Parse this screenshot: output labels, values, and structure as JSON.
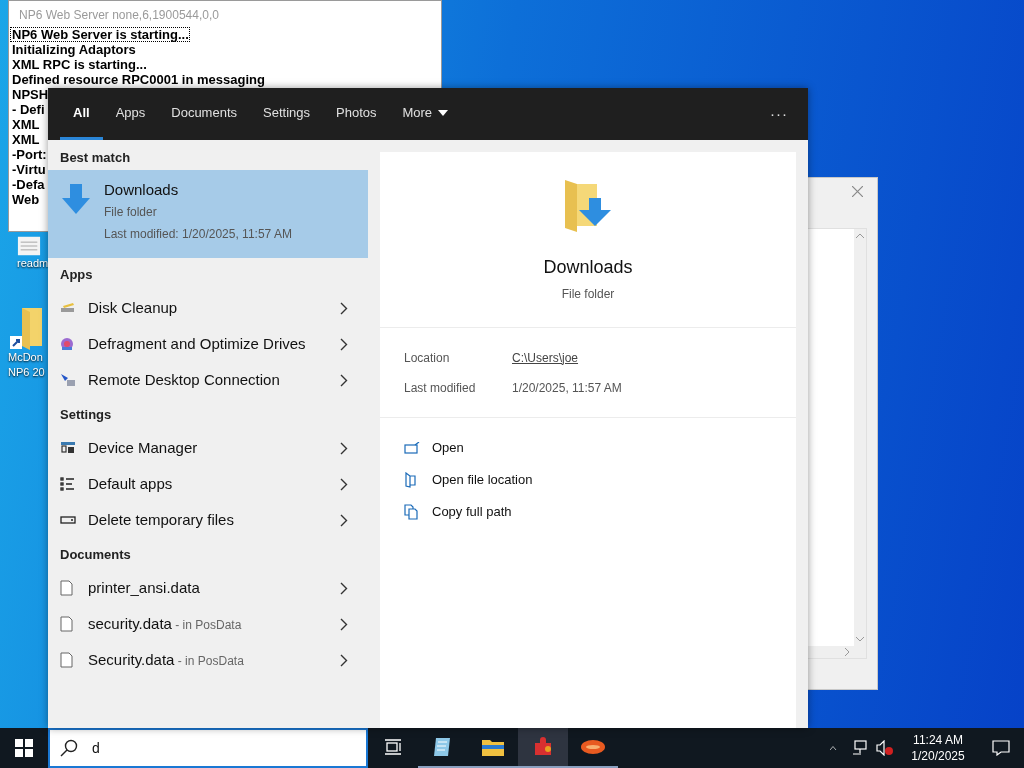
{
  "console_window": {
    "title": "NP6 Web Server none,6,1900544,0,0",
    "lines": [
      {
        "text": "NP6 Web Server is starting...",
        "focused": true
      },
      {
        "text": "Initializing Adaptors",
        "focused": false
      },
      {
        "text": "XML RPC is starting...",
        "focused": false
      },
      {
        "text": "Defined resource RPC0001 in messaging",
        "focused": false
      },
      {
        "text": "NPSH",
        "focused": false
      },
      {
        "text": "- Defi",
        "focused": false
      },
      {
        "text": "XML",
        "focused": false
      },
      {
        "text": "XML",
        "focused": false
      },
      {
        "text": "-Port:",
        "focused": false
      },
      {
        "text": "-Virtu",
        "focused": false
      },
      {
        "text": "-Defa",
        "focused": false
      },
      {
        "text": "Web",
        "focused": false
      }
    ]
  },
  "desktop_icons": [
    {
      "kind": "document",
      "lines": [
        "readm"
      ]
    },
    {
      "kind": "folder-shortcut",
      "lines": [
        "McDon",
        "NP6 20"
      ]
    }
  ],
  "search_panel": {
    "tabs": [
      {
        "label": "All",
        "selected": true,
        "dropdown": false
      },
      {
        "label": "Apps",
        "selected": false,
        "dropdown": false
      },
      {
        "label": "Documents",
        "selected": false,
        "dropdown": false
      },
      {
        "label": "Settings",
        "selected": false,
        "dropdown": false
      },
      {
        "label": "Photos",
        "selected": false,
        "dropdown": false
      },
      {
        "label": "More",
        "selected": false,
        "dropdown": true
      }
    ],
    "overflow": "···",
    "best_match": {
      "heading": "Best match",
      "title": "Downloads",
      "type": "File folder",
      "modified": "Last modified: 1/20/2025, 11:57 AM",
      "selected": true
    },
    "groups": [
      {
        "heading": "Apps",
        "items": [
          {
            "kind": "disk-cleanup",
            "label": "Disk Cleanup"
          },
          {
            "kind": "defragment",
            "label": "Defragment and Optimize Drives"
          },
          {
            "kind": "remote-desktop",
            "label": "Remote Desktop Connection"
          }
        ]
      },
      {
        "heading": "Settings",
        "items": [
          {
            "kind": "device-manager",
            "label": "Device Manager"
          },
          {
            "kind": "default-apps",
            "label": "Default apps"
          },
          {
            "kind": "storage",
            "label": "Delete temporary files"
          }
        ]
      },
      {
        "heading": "Documents",
        "items": [
          {
            "kind": "file",
            "label": "printer_ansi.data"
          },
          {
            "kind": "file",
            "label": "security.data",
            "location": "- in PosData"
          },
          {
            "kind": "file",
            "label": "Security.data",
            "location": "- in PosData"
          }
        ]
      }
    ],
    "preview": {
      "title": "Downloads",
      "type": "File folder",
      "details": [
        {
          "label": "Location",
          "value": "C:\\Users\\joe",
          "link": true
        },
        {
          "label": "Last modified",
          "value": "1/20/2025, 11:57 AM",
          "link": false
        }
      ],
      "actions": [
        {
          "kind": "open",
          "label": "Open"
        },
        {
          "kind": "open-location",
          "label": "Open file location"
        },
        {
          "kind": "copy-path",
          "label": "Copy full path"
        }
      ]
    }
  },
  "taskbar": {
    "search_value": "d",
    "apps": [
      {
        "kind": "task-view",
        "running": false,
        "selected": false
      },
      {
        "kind": "notepad",
        "running": true,
        "selected": false
      },
      {
        "kind": "file-explorer",
        "running": true,
        "selected": false
      },
      {
        "kind": "puzzle",
        "running": true,
        "selected": true
      },
      {
        "kind": "oval",
        "running": true,
        "selected": false
      }
    ],
    "clock": {
      "time": "11:24 AM",
      "date": "1/20/2025"
    }
  }
}
